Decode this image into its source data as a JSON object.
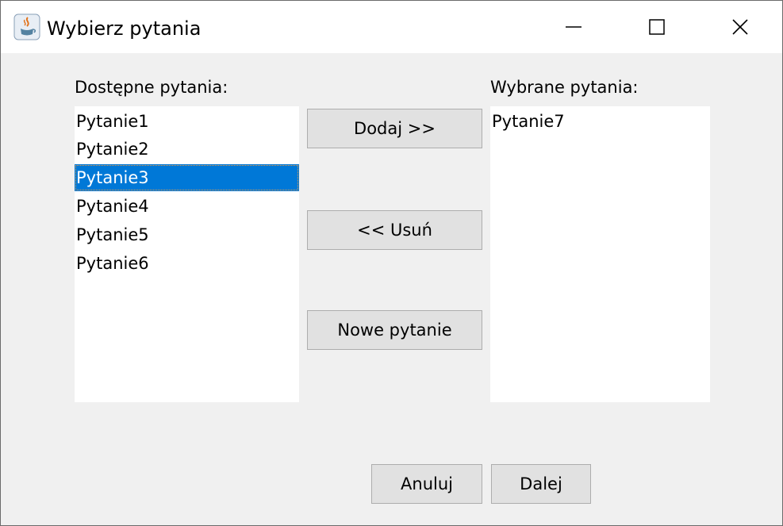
{
  "window": {
    "title": "Wybierz pytania",
    "controls": {
      "minimize": "minimize-icon",
      "maximize": "maximize-icon",
      "close": "close-icon"
    }
  },
  "available": {
    "label": "Dostępne pytania:",
    "items": [
      "Pytanie1",
      "Pytanie2",
      "Pytanie3",
      "Pytanie4",
      "Pytanie5",
      "Pytanie6"
    ],
    "selected": "Pytanie3"
  },
  "selected_list": {
    "label": "Wybrane pytania:",
    "items": [
      "Pytanie7"
    ]
  },
  "actions": {
    "add": "Dodaj >>",
    "remove": "<< Usuń",
    "new_question": "Nowe pytanie"
  },
  "footer": {
    "cancel": "Anuluj",
    "next": "Dalej"
  },
  "colors": {
    "selection": "#0078d7",
    "button_bg": "#e1e1e1",
    "dialog_bg": "#f0f0f0"
  }
}
